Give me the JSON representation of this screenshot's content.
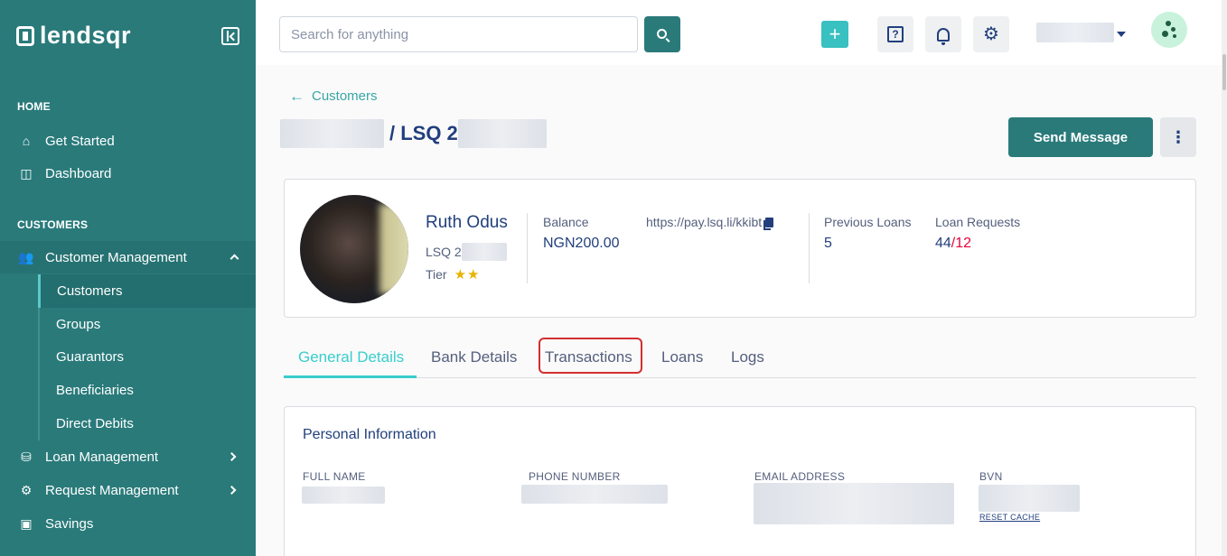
{
  "brand": {
    "name": "lendsqr"
  },
  "sidebar": {
    "sections": [
      {
        "label": "HOME"
      },
      {
        "label": "CUSTOMERS"
      }
    ],
    "home_items": [
      {
        "label": "Get Started"
      },
      {
        "label": "Dashboard"
      }
    ],
    "customer_management": {
      "label": "Customer Management",
      "children": [
        {
          "label": "Customers"
        },
        {
          "label": "Groups"
        },
        {
          "label": "Guarantors"
        },
        {
          "label": "Beneficiaries"
        },
        {
          "label": "Direct Debits"
        }
      ]
    },
    "other_items": [
      {
        "label": "Loan Management"
      },
      {
        "label": "Request Management"
      },
      {
        "label": "Savings"
      }
    ]
  },
  "topbar": {
    "search": {
      "placeholder": "Search for anything",
      "value": ""
    },
    "add_label": "+"
  },
  "page": {
    "back_label": "Customers",
    "title_suffix": "/ LSQ 2",
    "send_message_label": "Send Message",
    "more_label": "⋮"
  },
  "customer": {
    "name": "Ruth Odus",
    "id_prefix": "LSQ 2",
    "tier_label": "Tier",
    "tier_stars": "★★",
    "balance_label": "Balance",
    "balance_value": "NGN200.00",
    "pay_link": "https://pay.lsq.li/kkibt",
    "previous_loans_label": "Previous Loans",
    "previous_loans_value": "5",
    "loan_requests_label": "Loan Requests",
    "loan_requests_value": "44",
    "loan_requests_sep": "/",
    "loan_requests_red": "12"
  },
  "tabs": [
    {
      "label": "General Details"
    },
    {
      "label": "Bank Details"
    },
    {
      "label": "Transactions"
    },
    {
      "label": "Loans"
    },
    {
      "label": "Logs"
    }
  ],
  "personal_info": {
    "title": "Personal Information",
    "fields": [
      {
        "label": "FULL NAME"
      },
      {
        "label": "PHONE NUMBER"
      },
      {
        "label": "EMAIL ADDRESS"
      },
      {
        "label": "BVN"
      }
    ],
    "reset_cache_label": "RESET CACHE"
  },
  "colors": {
    "sidebar_bg": "#2a7a7a",
    "accent_teal": "#39cdcc",
    "primary_text": "#213f7d",
    "error_red": "#e4033b",
    "highlight_red": "#d32f2f"
  }
}
